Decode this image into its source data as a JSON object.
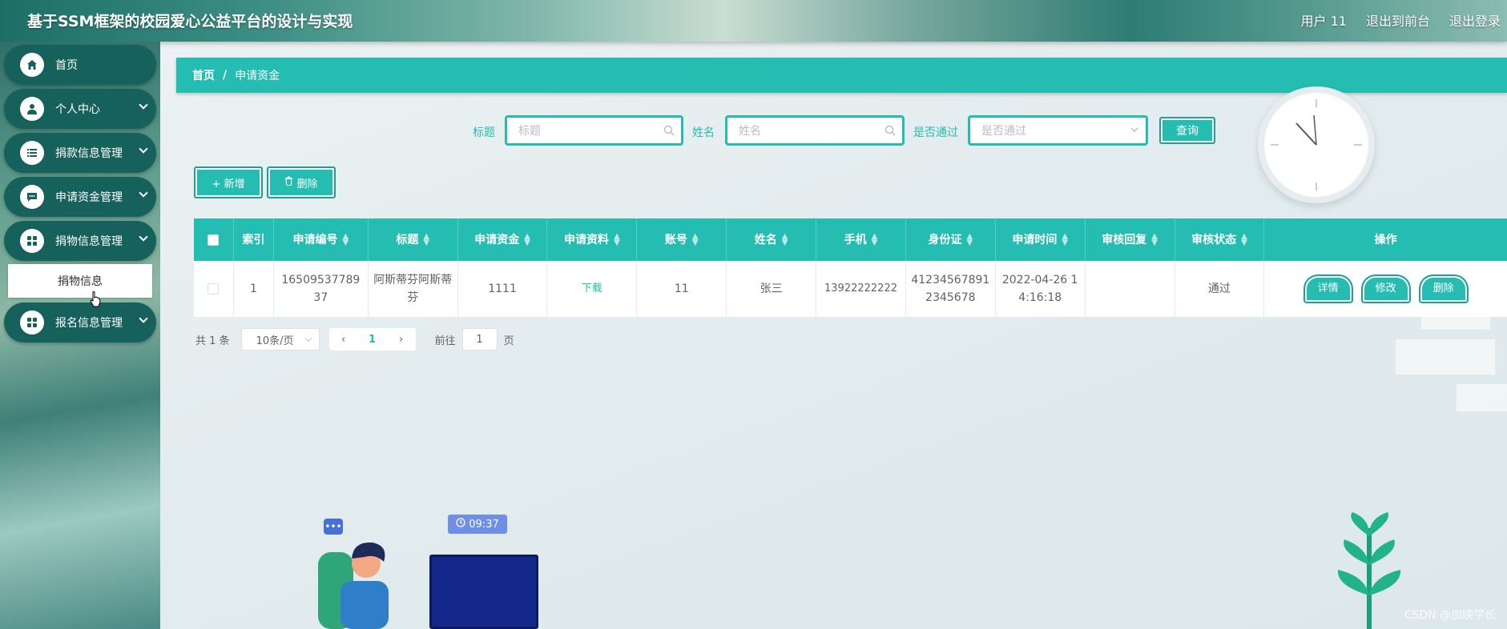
{
  "header": {
    "title": "基于SSM框架的校园爱心公益平台的设计与实现",
    "user": "用户 11",
    "back_to_front": "退出到前台",
    "logout": "退出登录"
  },
  "sidebar": {
    "items": [
      {
        "label": "首页",
        "icon": "home-icon"
      },
      {
        "label": "个人中心",
        "icon": "user-icon"
      },
      {
        "label": "捐款信息管理",
        "icon": "list-icon"
      },
      {
        "label": "申请资金管理",
        "icon": "chat-icon"
      },
      {
        "label": "捐物信息管理",
        "icon": "grid-icon"
      },
      {
        "label": "报名信息管理",
        "icon": "grid-icon"
      }
    ],
    "submenu": {
      "label": "捐物信息"
    }
  },
  "breadcrumb": {
    "home": "首页",
    "separator": "/",
    "current": "申请资金"
  },
  "search": {
    "title_label": "标题",
    "title_placeholder": "标题",
    "name_label": "姓名",
    "name_placeholder": "姓名",
    "passed_label": "是否通过",
    "passed_placeholder": "是否通过",
    "query_label": "查询"
  },
  "actions": {
    "add_label": "+ 新增",
    "delete_label": "删除"
  },
  "table": {
    "headers": [
      "索引",
      "申请编号",
      "标题",
      "申请资金",
      "申请资料",
      "账号",
      "姓名",
      "手机",
      "身份证",
      "申请时间",
      "审核回复",
      "审核状态",
      "操作"
    ],
    "rows": [
      {
        "index": "1",
        "app_no": "1650953778937",
        "title": "阿斯蒂芬阿斯蒂芬",
        "amount": "1111",
        "material": "下载",
        "account": "11",
        "name": "张三",
        "phone": "13922222222",
        "id_card": "412345678912345678",
        "time": "2022-04-26 14:16:18",
        "reply": "",
        "status": "通过",
        "ops": {
          "detail": "详情",
          "edit": "修改",
          "delete": "删除"
        }
      }
    ]
  },
  "pagination": {
    "total": "共 1 条",
    "page_size": "10条/页",
    "current_page": "1",
    "goto_prefix": "前往",
    "goto_value": "1",
    "goto_suffix": "页"
  },
  "decor": {
    "time_badge": "09:37",
    "watermark": "CSDN @加映学长"
  },
  "colors": {
    "accent": "#25bdb2",
    "sidebar_item": "#17615c"
  }
}
